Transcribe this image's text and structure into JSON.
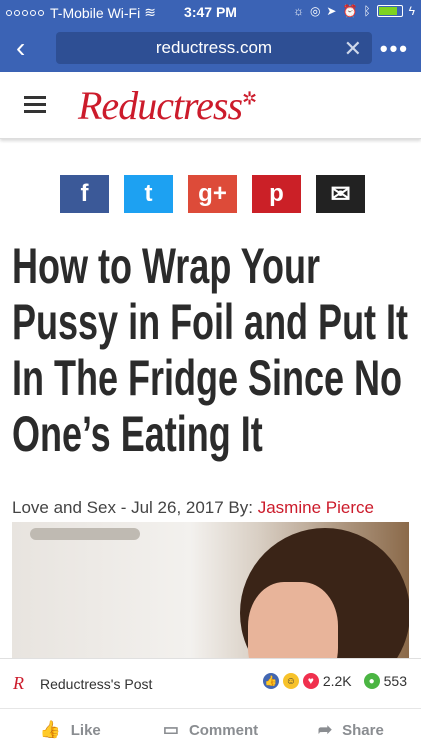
{
  "status": {
    "carrier": "T-Mobile Wi-Fi",
    "time": "3:47 PM"
  },
  "browser": {
    "url": "reductress.com"
  },
  "site": {
    "logo": "Reductress",
    "logo_star": "✲"
  },
  "share": {
    "facebook": "f",
    "twitter": "t",
    "google_plus": "g+",
    "pinterest": "p",
    "email": "✉"
  },
  "article": {
    "headline_lines": [
      "How to Wrap Your",
      "Pussy in Foil and Put It",
      "In The Fridge Since No",
      "One’s Eating It"
    ],
    "byline_prefix": "Love and Sex - Jul 26, 2017 By: ",
    "author": "Jasmine Pierce"
  },
  "fb": {
    "logo": "R",
    "post_label": "Reductress's Post",
    "reactions_count": "2.2K",
    "comments_count": "553",
    "like": "Like",
    "comment": "Comment",
    "share": "Share"
  },
  "colors": {
    "brand": "#cc1b2b",
    "chrome": "#3b63b5"
  }
}
